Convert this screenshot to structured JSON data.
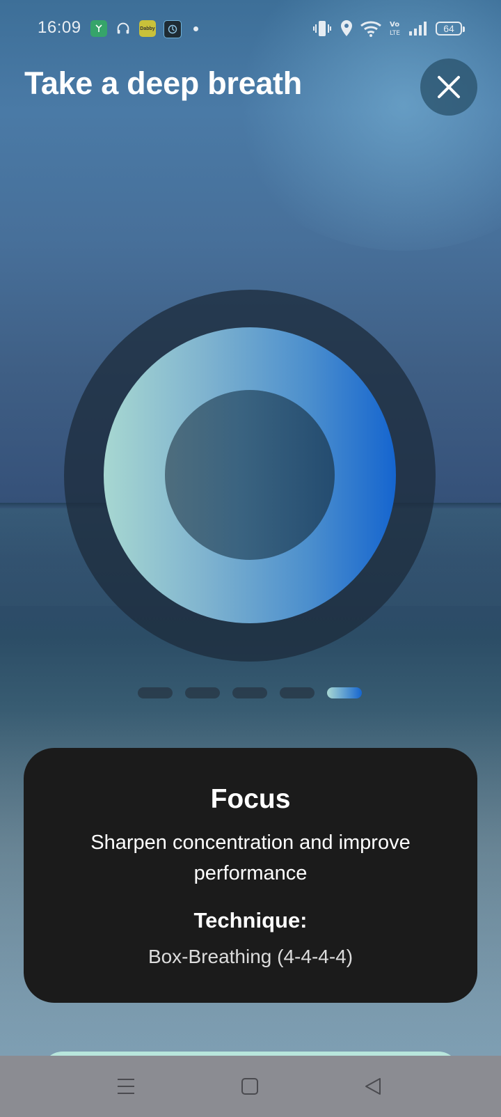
{
  "status_bar": {
    "time": "16:09",
    "battery": "64",
    "notification_icons": [
      "app-icon-green",
      "headphones-icon",
      "dabby-icon",
      "app-icon-dark"
    ],
    "yellow_app_label": "Dabby"
  },
  "header": {
    "title": "Take a deep breath"
  },
  "pagination": {
    "total": 5,
    "active_index": 4
  },
  "card": {
    "title": "Focus",
    "description": "Sharpen concentration and improve performance",
    "technique_label": "Technique:",
    "technique_value": "Box-Breathing (4-4-4-4)"
  },
  "colors": {
    "ring_gradient_start": "#a7d7d1",
    "ring_gradient_end": "#1565cf",
    "card_background": "#1b1b1b"
  }
}
